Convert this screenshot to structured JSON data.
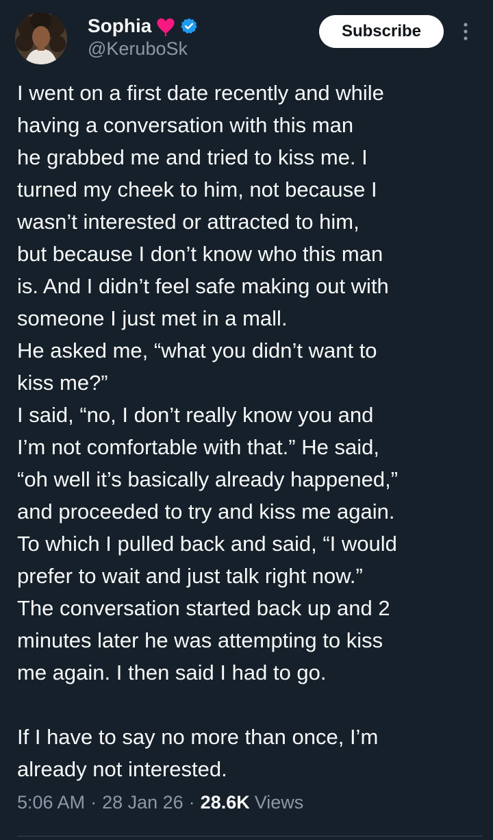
{
  "author": {
    "display_name": "Sophia",
    "handle": "@KeruboSk",
    "badge_icon": "heart-icon",
    "verified_icon": "verified-badge-icon",
    "heart_color": "#f91880",
    "verified_color": "#1d9bf0"
  },
  "actions": {
    "subscribe_label": "Subscribe",
    "more_icon": "more-options-icon"
  },
  "tweet": {
    "lines": [
      "I went on a first date recently and while",
      "having a conversation with this man",
      "he grabbed me and tried to kiss me. I",
      "turned my cheek to him, not because I",
      "wasn’t interested or attracted to him,",
      "but because I don’t know who this man",
      "is. And I didn’t feel safe making out with",
      "someone I just met in a mall.",
      "He asked me, “what you didn’t want to",
      "kiss me?”",
      "I said, “no, I don’t really know you and",
      "I’m not comfortable with that.” He said,",
      "“oh well it’s basically already happened,”",
      "and proceeded to try and kiss me again.",
      "To which I pulled back and said, “I would",
      "prefer to wait and just talk right now.”",
      "The conversation started back up and 2",
      "minutes later he was attempting to kiss",
      "me again. I then said I had to go.",
      "",
      "If I have to say no more than once, I’m",
      "already not interested."
    ]
  },
  "meta": {
    "time": "5:06 AM",
    "separator": "·",
    "date": "28 Jan 26",
    "views_count": "28.6K",
    "views_label": "Views"
  },
  "colors": {
    "background": "#15202b",
    "text_primary": "#f7f9f9",
    "text_secondary": "#8b98a5",
    "button_bg": "#ffffff",
    "button_text": "#0f1419"
  }
}
